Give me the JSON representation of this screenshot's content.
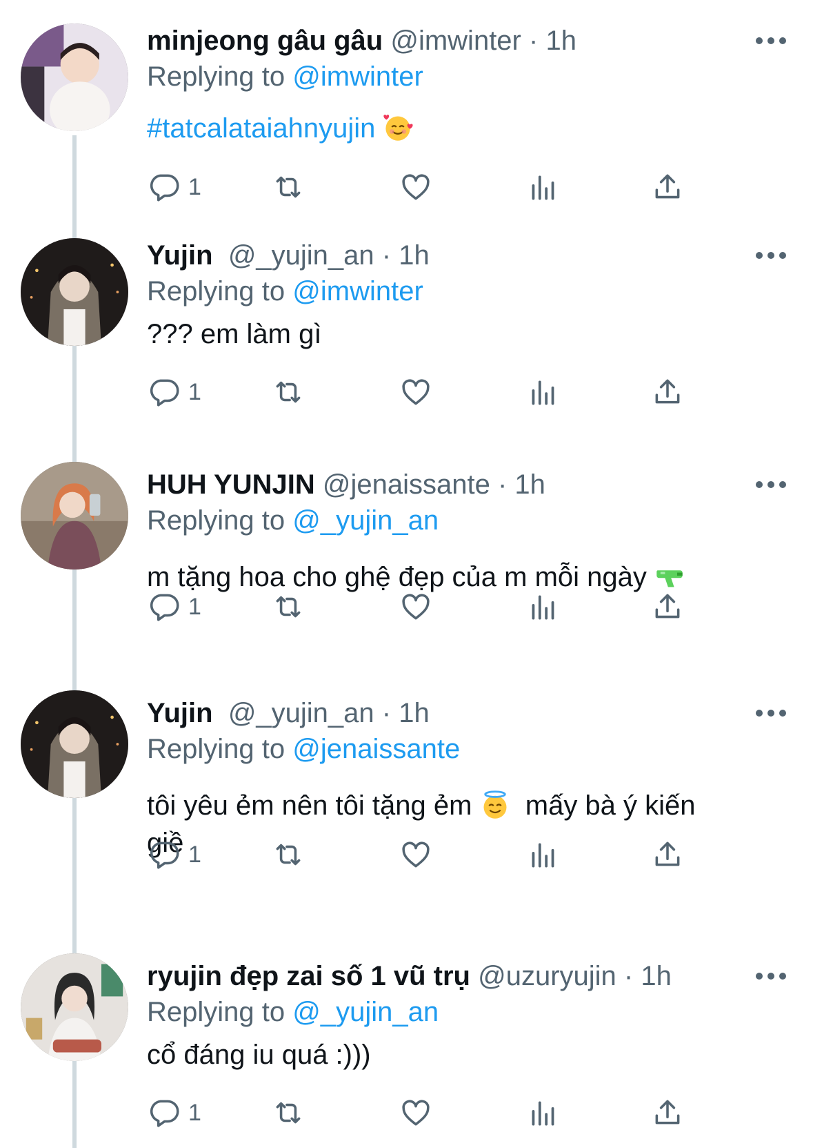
{
  "tweets": [
    {
      "name": "minjeong gâu gâu",
      "handle": "@imwinter",
      "sep": "·",
      "time": "1h",
      "replying_prefix": "Replying to",
      "replying_to": "@imwinter",
      "text_parts": [
        "#tatcalataiahnyujin"
      ],
      "emoji": "smiling-face-with-hearts",
      "reply_count": "1",
      "avatar_colors": [
        "#e9e3ec",
        "#7a5a8a",
        "#f3d9c8"
      ]
    },
    {
      "name": "Yujin",
      "handle": "@_yujin_an",
      "sep": "·",
      "time": "1h",
      "replying_prefix": "Replying to",
      "replying_to": "@imwinter",
      "text_parts": [
        "??? em làm gì"
      ],
      "reply_count": "1",
      "avatar_colors": [
        "#1f1b1a",
        "#7a7064",
        "#e8d6c8"
      ]
    },
    {
      "name": "HUH YUNJIN",
      "handle": "@jenaissante",
      "sep": "·",
      "time": "1h",
      "replying_prefix": "Replying to",
      "replying_to": "@_yujin_an",
      "text_parts": [
        "m tặng hoa cho ghệ đẹp của m mỗi ngày"
      ],
      "emoji": "water-pistol",
      "reply_count": "1",
      "avatar_colors": [
        "#a89a8a",
        "#d97a4a",
        "#7a4e5a"
      ]
    },
    {
      "name": "Yujin",
      "handle": "@_yujin_an",
      "sep": "·",
      "time": "1h",
      "replying_prefix": "Replying to",
      "replying_to": "@jenaissante",
      "text_parts": [
        "tôi yêu ẻm nên tôi tặng ẻm",
        "mấy bà ý kiến",
        "giề"
      ],
      "emoji": "smiling-face-with-halo",
      "reply_count": "1",
      "avatar_colors": [
        "#1f1b1a",
        "#7a7064",
        "#e8d6c8"
      ]
    },
    {
      "name": "ryujin đẹp zai số 1 vũ trụ",
      "handle": "@uzuryujin",
      "sep": "·",
      "time": "1h",
      "replying_prefix": "Replying to",
      "replying_to": "@_yujin_an",
      "text_parts": [
        "cổ đáng iu quá :)))"
      ],
      "reply_count": "1",
      "avatar_colors": [
        "#e6e2de",
        "#2a2a2a",
        "#b85a4a"
      ]
    }
  ],
  "icons": [
    "reply-icon",
    "retweet-icon",
    "like-icon",
    "views-icon",
    "share-icon",
    "more-icon"
  ],
  "colors": {
    "link": "#1d9bf0",
    "secondary": "#536471",
    "thread_line": "#cfd9de"
  }
}
